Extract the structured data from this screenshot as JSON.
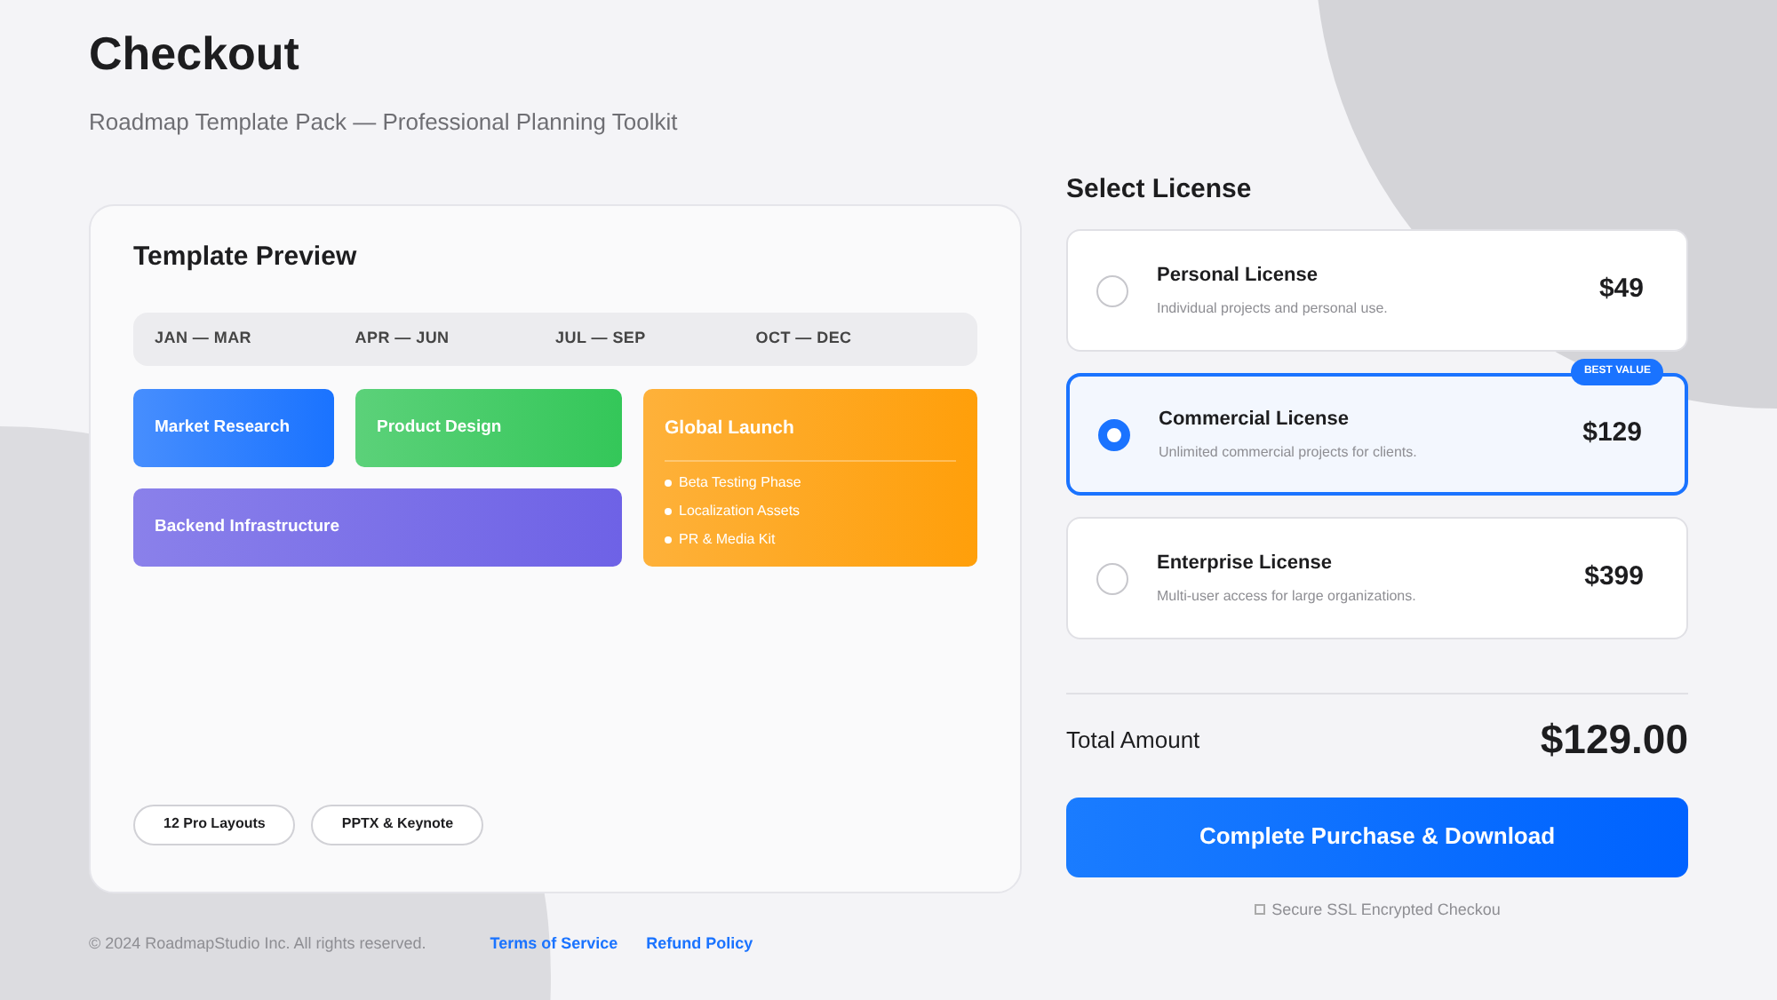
{
  "header": {
    "title": "Checkout",
    "subtitle": "Roadmap Template Pack — Professional Planning Toolkit"
  },
  "preview": {
    "title": "Template Preview",
    "quarters": [
      "JAN — MAR",
      "APR — JUN",
      "JUL — SEP",
      "OCT — DEC"
    ],
    "tasks": [
      {
        "kind": "bar",
        "label": "Market Research",
        "color": "#1a73ff"
      },
      {
        "kind": "bar",
        "label": "Product Design",
        "color": "#34c759"
      },
      {
        "kind": "list",
        "label": "Global Launch",
        "color": "#ff9f0a",
        "items": [
          "Beta Testing Phase",
          "Localization Assets",
          "PR & Media Kit"
        ]
      },
      {
        "kind": "bar",
        "label": "Backend Infrastructure",
        "color": "#6e62e6"
      }
    ],
    "tags": [
      "12 Pro Layouts",
      "PPTX & Keynote"
    ]
  },
  "footer": {
    "copyright": "© 2024 RoadmapStudio Inc. All rights reserved.",
    "links": [
      "Terms of Service",
      "Refund Policy"
    ]
  },
  "license": {
    "title": "Select License",
    "options": [
      {
        "name": "Personal License",
        "description": "Individual projects and personal use.",
        "price": "$49",
        "selected": false
      },
      {
        "name": "Commercial License",
        "description": "Unlimited commercial projects for clients.",
        "price": "$129",
        "selected": true,
        "badge": "BEST VALUE"
      },
      {
        "name": "Enterprise License",
        "description": "Multi-user access for large organizations.",
        "price": "$399",
        "selected": false
      }
    ],
    "total_label": "Total Amount",
    "total": "$129.00",
    "button": "Complete Purchase & Download",
    "secure_note": "Secure SSL Encrypted Checkou"
  }
}
